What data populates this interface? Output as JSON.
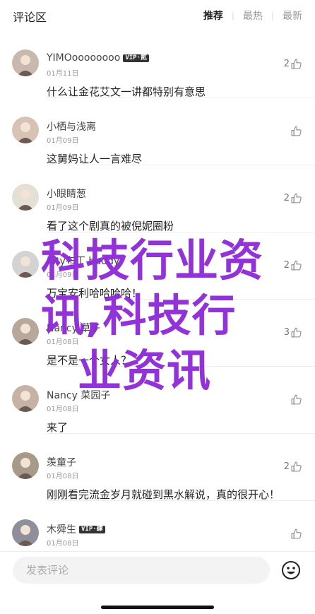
{
  "header": {
    "title": "评论区",
    "tabs": [
      {
        "label": "推荐",
        "active": true
      },
      {
        "label": "最热",
        "active": false
      },
      {
        "label": "最新",
        "active": false
      }
    ]
  },
  "comments": [
    {
      "name": "YIMOoooooooo",
      "badge": "VIP·贰",
      "date": "01月11日",
      "text": "什么让金花艾文一讲都特别有意思",
      "likes": "2",
      "avatar": "avatar-woman-icon"
    },
    {
      "name": "小栖与浅离",
      "badge": "",
      "date": "01月09日",
      "text": "这舅妈让人一言难尽",
      "likes": "",
      "avatar": "avatar-woman-icon"
    },
    {
      "name": "小眼睛葱",
      "badge": "",
      "date": "01月09日",
      "text": "看了这个剧真的被倪妮圈粉",
      "likes": "2",
      "avatar": "avatar-dog-icon"
    },
    {
      "name": "Kity布丁 buddy",
      "badge": "",
      "date": "01月09日",
      "text": "万宝安利哈哈哈哈！",
      "likes": "2",
      "avatar": "avatar-cat-icon"
    },
    {
      "name": "Nancy 草子",
      "badge": "",
      "date": "01月08日",
      "text": "是不是一个女人？",
      "likes": "3",
      "avatar": "avatar-woman-icon"
    },
    {
      "name": "Nancy 菜园子",
      "badge": "",
      "date": "01月08日",
      "text": "来了",
      "likes": "",
      "avatar": "avatar-woman-icon"
    },
    {
      "name": "羡童子",
      "badge": "",
      "date": "01月08日",
      "text": "刚刚看完流金岁月就碰到黑水解说，真的很开心！",
      "likes": "2",
      "avatar": "avatar-person-icon"
    },
    {
      "name": "木舜生",
      "badge": "VIP·肆",
      "date": "01月08日",
      "text": "",
      "likes": "",
      "avatar": "avatar-person-icon"
    }
  ],
  "footer": {
    "input_placeholder": "发表评论",
    "emoji_icon": "emoji-icon"
  },
  "watermark": {
    "lines": [
      "科技行业资",
      "讯,科技行",
      "业资讯"
    ],
    "color": "#8e2bd8"
  }
}
